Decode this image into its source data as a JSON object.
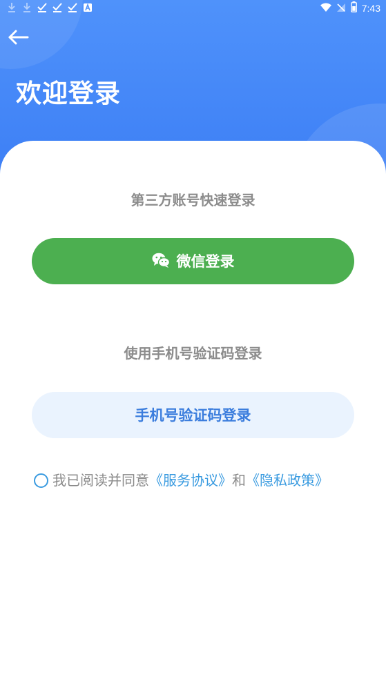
{
  "status_bar": {
    "time": "7:43",
    "left_icons": [
      "download-icon",
      "download-icon",
      "check-icon",
      "check-icon",
      "check-icon",
      "text-a-icon"
    ],
    "right_icons": [
      "wifi-icon",
      "no-signal-icon",
      "battery-icon"
    ]
  },
  "header": {
    "back_icon": "arrow-left-icon",
    "title": "欢迎登录"
  },
  "third_party": {
    "label": "第三方账号快速登录",
    "wechat_button": {
      "icon": "wechat-icon",
      "label": "微信登录"
    }
  },
  "phone_login": {
    "label": "使用手机号验证码登录",
    "button_label": "手机号验证码登录"
  },
  "agreement": {
    "checked": false,
    "prefix": "我已阅读并同意",
    "service_link": "《服务协议》",
    "conjunction": "和",
    "privacy_link": "《隐私政策》"
  },
  "colors": {
    "header_blue": "#4f92fb",
    "wechat_green": "#4caf50",
    "phone_button_bg": "#eaf3fe",
    "phone_button_text": "#3b7ddd",
    "link_blue": "#3a9be0",
    "label_gray": "#8c8c8c"
  }
}
